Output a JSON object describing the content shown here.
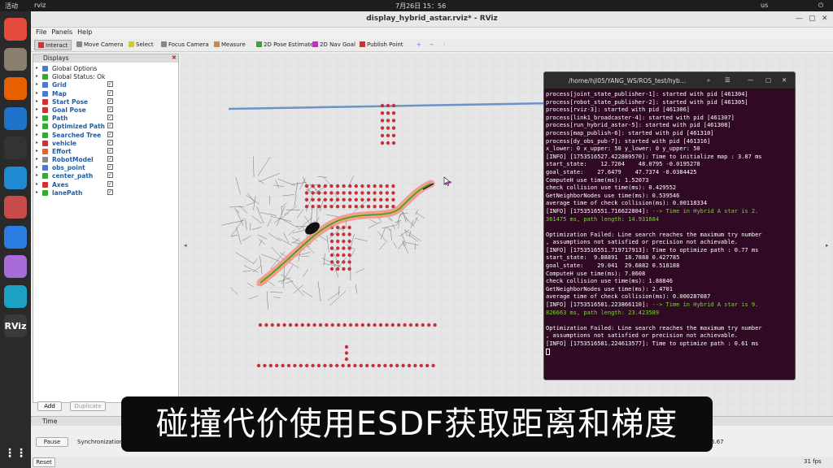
{
  "topbar": {
    "activities": "活动",
    "app": "rviz",
    "clock": "7月26日  15：56",
    "lang": "us"
  },
  "dock": [
    {
      "icon": "chrome-icon",
      "color": "#e54b3c"
    },
    {
      "icon": "files-icon",
      "color": "#8a7f6f"
    },
    {
      "icon": "firefox-icon",
      "color": "#e66000"
    },
    {
      "icon": "app-icon",
      "color": "#1e73c8"
    },
    {
      "icon": "terminal-icon",
      "color": "#333333"
    },
    {
      "icon": "vscode-icon",
      "color": "#1f8ad2"
    },
    {
      "icon": "document-icon",
      "color": "#c94a4a"
    },
    {
      "icon": "cloud-icon",
      "color": "#2b7de0"
    },
    {
      "icon": "cat-icon",
      "color": "#a86cd8"
    },
    {
      "icon": "edge-icon",
      "color": "#1da1c5"
    },
    {
      "icon": "rviz-icon",
      "color": "#3a3a3a",
      "label": "RViz"
    }
  ],
  "window": {
    "title": "display_hybrid_astar.rviz* - RViz"
  },
  "menu": [
    "File",
    "Panels",
    "Help"
  ],
  "toolbar": [
    {
      "label": "Interact",
      "icon": "cursor-icon",
      "color": "#c33"
    },
    {
      "label": "Move Camera",
      "icon": "camera-move-icon",
      "color": "#888"
    },
    {
      "label": "Select",
      "icon": "select-icon",
      "color": "#cc3"
    },
    {
      "label": "Focus Camera",
      "icon": "focus-icon",
      "color": "#888"
    },
    {
      "label": "Measure",
      "icon": "ruler-icon",
      "color": "#c84"
    },
    {
      "label": "2D Pose Estimate",
      "icon": "pose-estimate-icon",
      "color": "#3a3"
    },
    {
      "label": "2D Nav Goal",
      "icon": "nav-goal-icon",
      "color": "#b3b"
    },
    {
      "label": "Publish Point",
      "icon": "pin-icon",
      "color": "#c33"
    }
  ],
  "displays": {
    "header": "Displays",
    "items": [
      {
        "label": "Global Options",
        "icon": "gear-icon",
        "color": "#4a7bd0",
        "plain": true,
        "checkbox": false
      },
      {
        "label": "Global Status: Ok",
        "icon": "check-icon",
        "color": "#3a3",
        "plain": true,
        "checkbox": false
      },
      {
        "label": "Grid",
        "icon": "grid-icon",
        "color": "#4a7bd0",
        "checkbox": true
      },
      {
        "label": "Map",
        "icon": "map-icon",
        "color": "#4a7bd0",
        "checkbox": true
      },
      {
        "label": "Start Pose",
        "icon": "arrow-icon",
        "color": "#c33",
        "checkbox": true
      },
      {
        "label": "Goal Pose",
        "icon": "arrow-icon",
        "color": "#c33",
        "checkbox": true
      },
      {
        "label": "Path",
        "icon": "path-icon",
        "color": "#3a3",
        "checkbox": true
      },
      {
        "label": "Optimized Path",
        "icon": "path-icon",
        "color": "#3a3",
        "checkbox": true
      },
      {
        "label": "Searched Tree",
        "icon": "tree-icon",
        "color": "#3a3",
        "checkbox": true
      },
      {
        "label": "vehicle",
        "icon": "marker-icon",
        "color": "#c33",
        "checkbox": true
      },
      {
        "label": "Effort",
        "icon": "effort-icon",
        "color": "#d63",
        "checkbox": true
      },
      {
        "label": "RobotModel",
        "icon": "robot-icon",
        "color": "#888",
        "checkbox": true
      },
      {
        "label": "obs_point",
        "icon": "points-icon",
        "color": "#4a7bd0",
        "checkbox": true
      },
      {
        "label": "center_path",
        "icon": "path-icon",
        "color": "#3a3",
        "checkbox": true
      },
      {
        "label": "Axes",
        "icon": "axes-icon",
        "color": "#c33",
        "checkbox": true
      },
      {
        "label": "lanePath",
        "icon": "path-icon",
        "color": "#3a3",
        "checkbox": true
      }
    ],
    "buttons": {
      "add": "Add",
      "duplicate": "Duplicate"
    }
  },
  "terminal": {
    "title": "/home/hjl05/YANG_WS/ROS_test/hyb...",
    "lines": [
      {
        "t": "process[joint_state_publisher-1]: started with pid [461304]",
        "c": ""
      },
      {
        "t": "process[robot_state_publisher-2]: started with pid [461305]",
        "c": ""
      },
      {
        "t": "process[rviz-3]: started with pid [461306]",
        "c": ""
      },
      {
        "t": "process[link1_broadcaster-4]: started with pid [461307]",
        "c": ""
      },
      {
        "t": "process[run_hybrid_astar-5]: started with pid [461308]",
        "c": ""
      },
      {
        "t": "process[map_publish-6]: started with pid [461310]",
        "c": ""
      },
      {
        "t": "process[dy_obs_pub-7]: started with pid [461316]",
        "c": ""
      },
      {
        "t": "x_lower: 0 x_upper: 50 y_lower: 0 y_upper: 50",
        "c": ""
      },
      {
        "t": "[INFO] [1753516527.422889570]: Time to initialize map : 3.87 ms",
        "c": ""
      },
      {
        "t": "start_state:    12.7204    48.0795 -0.0195278",
        "c": ""
      },
      {
        "t": "goal_state:    27.6479    47.7374 -0.0384425",
        "c": ""
      },
      {
        "t": "ComputeH use time(ms): 1.52073",
        "c": ""
      },
      {
        "t": "check collision use time(ms): 0.429552",
        "c": ""
      },
      {
        "t": "GetNeighborNodes use time(ms): 0.539546",
        "c": ""
      },
      {
        "t": "average time of check collision(ms): 0.00118334",
        "c": ""
      },
      {
        "t": "[INFO] [1753516551.716622804]: --> Time in Hybrid A star is 2.",
        "c": "mix"
      },
      {
        "t": "361475 ms, path length: 14.931684",
        "c": "green"
      },
      {
        "t": "",
        "c": ""
      },
      {
        "t": "Optimization Failed: Line search reaches the maximum try number",
        "c": ""
      },
      {
        "t": ", assumptions not satisfied or precision not achievable.",
        "c": ""
      },
      {
        "t": "[INFO] [1753516551.719717913]: Time to optimize path : 0.77 ms",
        "c": ""
      },
      {
        "t": "start_state:  9.88891  18.7888 0.427785",
        "c": ""
      },
      {
        "t": "goal_state:    29.041  29.6882 0.518188",
        "c": ""
      },
      {
        "t": "ComputeH use time(ms): 7.0608",
        "c": ""
      },
      {
        "t": "check collision use time(ms): 1.88846",
        "c": ""
      },
      {
        "t": "GetNeighborNodes use time(ms): 2.4701",
        "c": ""
      },
      {
        "t": "average time of check collision(ms): 0.000287087",
        "c": ""
      },
      {
        "t": "[INFO] [1753516581.223866110]: --> Time in Hybrid A star is 9.",
        "c": "mix"
      },
      {
        "t": "826663 ms, path length: 23.423589",
        "c": "green"
      },
      {
        "t": "",
        "c": ""
      },
      {
        "t": "Optimization Failed: Line search reaches the maximum try number",
        "c": ""
      },
      {
        "t": ", assumptions not satisfied or precision not achievable.",
        "c": ""
      },
      {
        "t": "[INFO] [1753516581.224613577]: Time to optimize path : 0.61 ms",
        "c": ""
      }
    ]
  },
  "time_panel": {
    "header": "Time",
    "pause": "Pause",
    "sync_label": "Synchronization",
    "value": "6.67"
  },
  "status": {
    "reset": "Reset",
    "fps": "31 fps"
  },
  "subtitle": "碰撞代价使用ESDF获取距离和梯度",
  "viewport": {
    "wall_color": "#6b93c5",
    "obstacle_color": "#c8313c",
    "path_color": "#2e9a2e",
    "corridor_color": "#f58a8a",
    "tree_color": "#555555"
  }
}
